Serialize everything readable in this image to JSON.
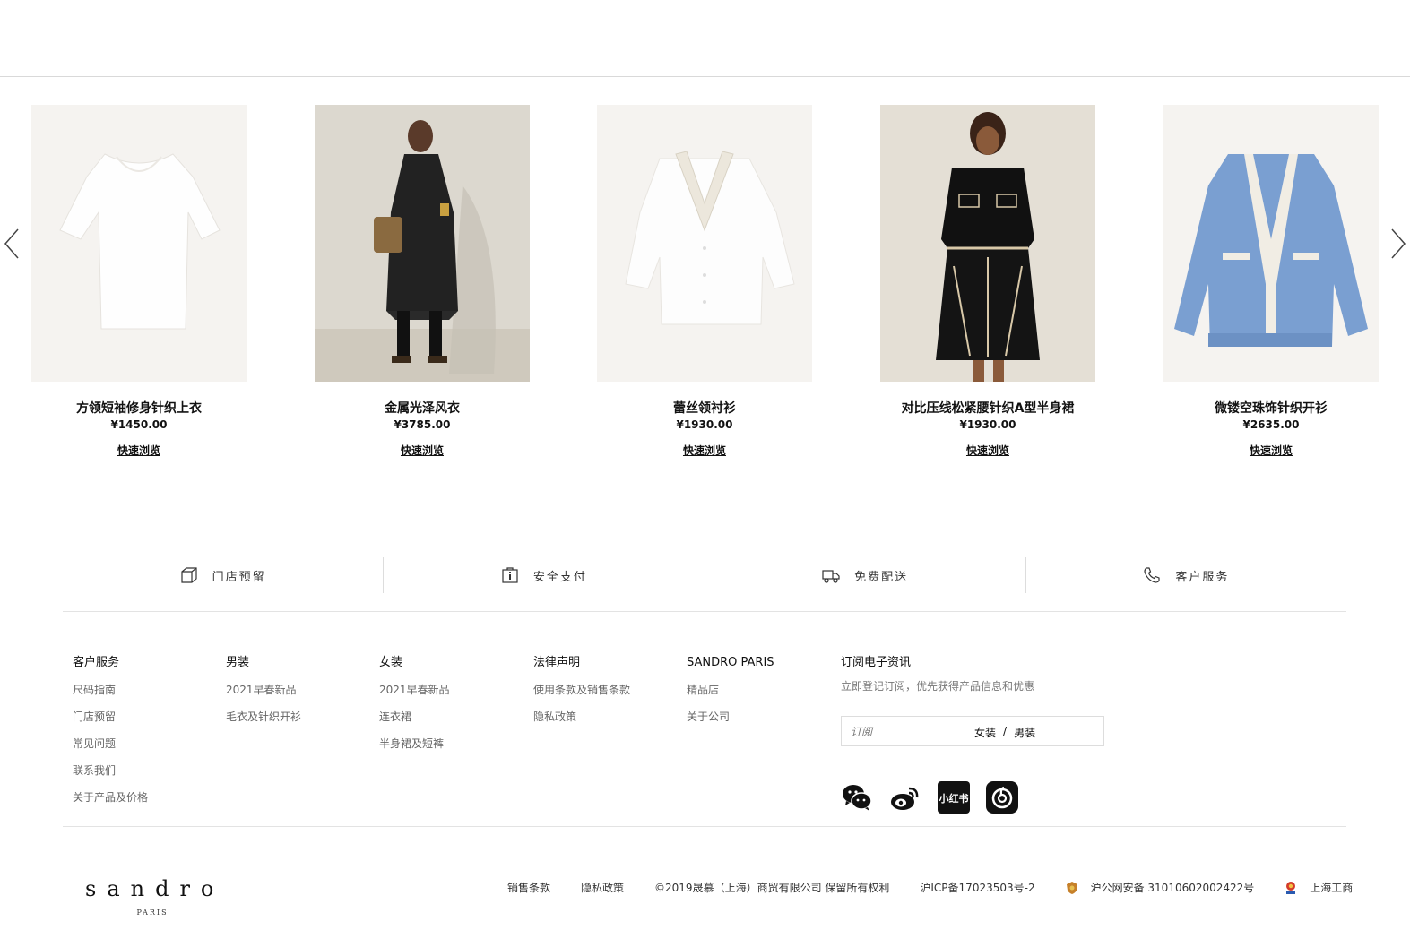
{
  "carousel": {
    "products": [
      {
        "name": "方领短袖修身针织上衣",
        "price": "¥1450.00",
        "quick_view": "快速浏览"
      },
      {
        "name": "金属光泽风衣",
        "price": "¥3785.00",
        "quick_view": "快速浏览"
      },
      {
        "name": "蕾丝领衬衫",
        "price": "¥1930.00",
        "quick_view": "快速浏览"
      },
      {
        "name": "对比压线松紧腰针织A型半身裙",
        "price": "¥1930.00",
        "quick_view": "快速浏览"
      },
      {
        "name": "微镂空珠饰针织开衫",
        "price": "¥2635.00",
        "quick_view": "快速浏览"
      }
    ]
  },
  "services": [
    {
      "label": "门店预留",
      "icon": "box-icon"
    },
    {
      "label": "安全支付",
      "icon": "secure-payment-icon"
    },
    {
      "label": "免费配送",
      "icon": "truck-icon"
    },
    {
      "label": "客户服务",
      "icon": "phone-icon"
    }
  ],
  "footer": {
    "columns": [
      {
        "title": "客户服务",
        "links": [
          "尺码指南",
          "门店预留",
          "常见问题",
          "联系我们",
          "关于产品及价格"
        ]
      },
      {
        "title": "男装",
        "links": [
          "2021早春新品",
          "毛衣及针织开衫"
        ]
      },
      {
        "title": "女装",
        "links": [
          "2021早春新品",
          "连衣裙",
          "半身裙及短裤"
        ]
      },
      {
        "title": "法律声明",
        "links": [
          "使用条款及销售条款",
          "隐私政策"
        ]
      },
      {
        "title": "SANDRO PARIS",
        "links": [
          "精品店",
          "关于公司"
        ]
      }
    ],
    "subscribe": {
      "title": "订阅电子资讯",
      "desc": "立即登记订阅，优先获得产品信息和优惠",
      "placeholder": "订阅",
      "women": "女装",
      "sep": "/",
      "men": "男装"
    },
    "social": [
      "wechat-icon",
      "weibo-icon",
      "xiaohongshu-icon",
      "netease-music-icon"
    ],
    "xiaohongshu_text": "小红书"
  },
  "bottom": {
    "logo_word": "sandro",
    "logo_sub": "PARIS",
    "sales_terms": "销售条款",
    "privacy": "隐私政策",
    "copyright": "©2019晟慕（上海）商贸有限公司 保留所有权利",
    "icp": "沪ICP备17023503号-2",
    "police": "沪公网安备 31010602002422号",
    "aic": "上海工商"
  },
  "colors": {
    "divider": "#e3e3e3",
    "text": "#222222",
    "accent_blue": "#7a9fd1"
  }
}
